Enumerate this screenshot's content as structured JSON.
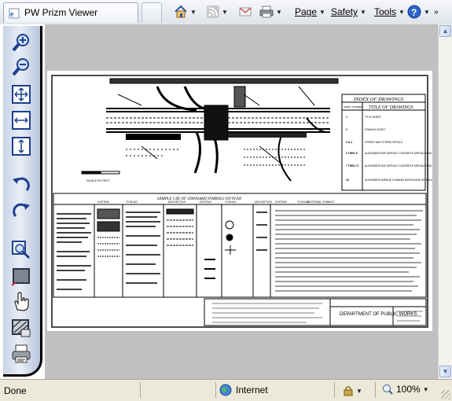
{
  "tab": {
    "title": "PW Prizm Viewer"
  },
  "command_bar": {
    "page_label": "Page",
    "safety_label": "Safety",
    "tools_label": "Tools"
  },
  "drawing": {
    "scale_label": "SCALE IN FEET",
    "legend_title": "SAMPLE USE OF STANDARD SYMBOLS ON PLAN",
    "legend_headers": [
      "EXISTING",
      "TO BUILD",
      "DESCRIPTION",
      "EXISTING",
      "TO BUILD",
      "DESCRIPTION",
      "EXISTING",
      "TO BUILD",
      "ADDITIONAL SYMBOLS"
    ],
    "index_title": "INDEX OF DRAWINGS",
    "index_col_sheet": "SHEET NUMBER",
    "index_col_title": "TITLE OF DRAWINGS",
    "index_rows": [
      {
        "num": "1",
        "title": "TITLE SHEET"
      },
      {
        "num": "2",
        "title": "STAKING SHEET"
      },
      {
        "num": "3 & 4",
        "title": "STREET AND STORM DETAILS"
      },
      {
        "num": "5 THRU 6",
        "title": "ALEXANDER AVE ASPHALT CONCRETE ASPHALT AND STORM AND CONSTRUCTION"
      },
      {
        "num": "7 THRU 17",
        "title": "ALEXANDER AVE ASPHALT CONCRETE ASPHALT AND STORM AND CONSTRUCTION"
      },
      {
        "num": "18",
        "title": "ALEXANDER AVENUE CHANNELIZATION AND SIGNALIZATION"
      }
    ],
    "department": "DEPARTMENT OF PUBLIC WORKS"
  },
  "status_bar": {
    "status_text": "Done",
    "zone": "Internet",
    "zoom": "100%"
  },
  "colors": {
    "viewer_bg": "#c0c0c0",
    "toolbar_bg": "#d7e0ef",
    "tab_bar_bg": "#e8ebf1"
  }
}
